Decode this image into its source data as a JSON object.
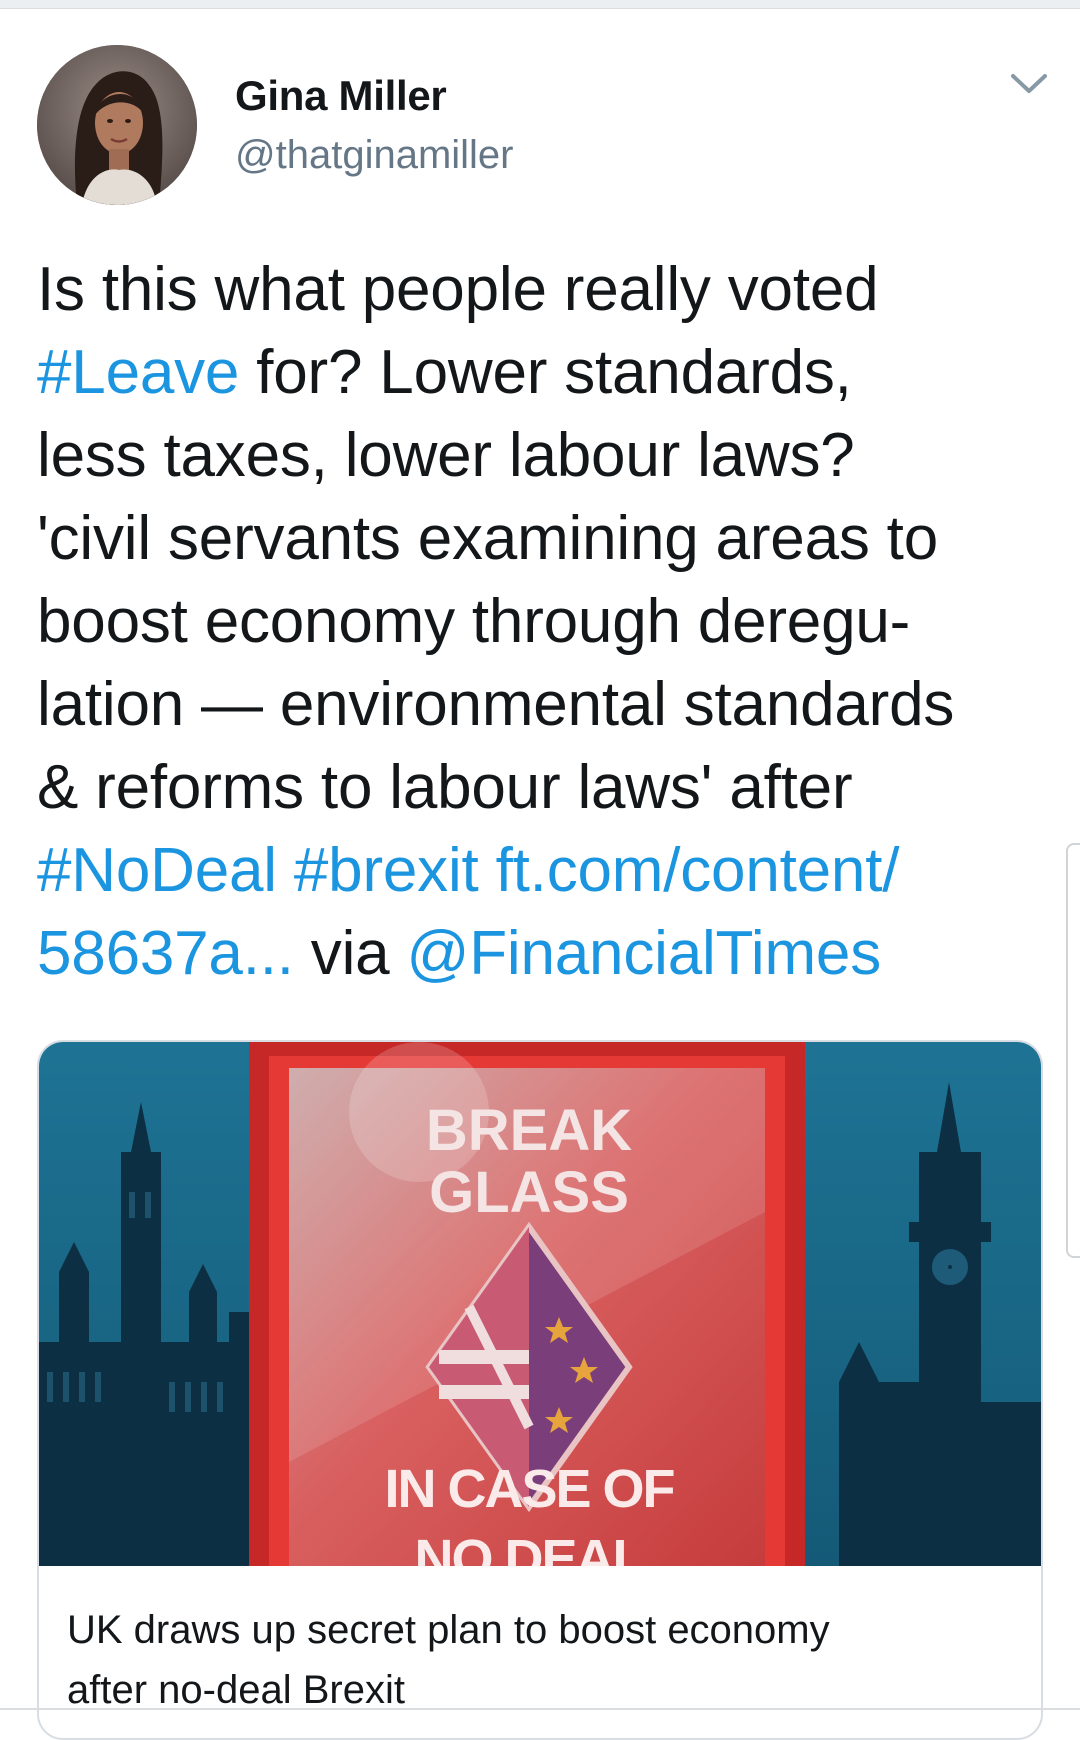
{
  "author": {
    "name": "Gina Miller",
    "handle": "@thatginamiller"
  },
  "tweet": {
    "lines": [
      [
        {
          "text": "Is this what people really voted",
          "link": false
        }
      ],
      [
        {
          "text": "#Leave",
          "link": true
        },
        {
          "text": " for? Lower standards,",
          "link": false
        }
      ],
      [
        {
          "text": "less taxes, lower labour laws?",
          "link": false
        }
      ],
      [
        {
          "text": "'civil servants examining areas to",
          "link": false
        }
      ],
      [
        {
          "text": "boost economy through deregu-",
          "link": false
        }
      ],
      [
        {
          "text": "lation — environmental standards",
          "link": false
        }
      ],
      [
        {
          "text": "& reforms to labour laws' after",
          "link": false
        }
      ],
      [
        {
          "text": "#NoDeal",
          "link": true
        },
        {
          "text": " ",
          "link": false
        },
        {
          "text": "#brexit",
          "link": true
        },
        {
          "text": " ",
          "link": false
        },
        {
          "text": "ft.com/content/",
          "link": true
        }
      ],
      [
        {
          "text": "58637a...",
          "link": true
        },
        {
          "text": " via ",
          "link": false
        },
        {
          "text": "@FinancialTimes",
          "link": true
        }
      ]
    ]
  },
  "card": {
    "image_text": {
      "line1": "BREAK",
      "line2": "GLASS",
      "line3": "IN CASE OF",
      "line4": "NO DEAL"
    },
    "title_lines": [
      "UK draws up secret plan to boost economy",
      "after no-deal Brexit"
    ]
  },
  "icons": {
    "menu": "chevron-down-icon",
    "avatar": "avatar-photo"
  },
  "colors": {
    "link": "#1b95e0",
    "text": "#14171a",
    "secondary": "#657786",
    "card_background": "#1a6e8e",
    "break_glass_red": "#d32f2f"
  }
}
